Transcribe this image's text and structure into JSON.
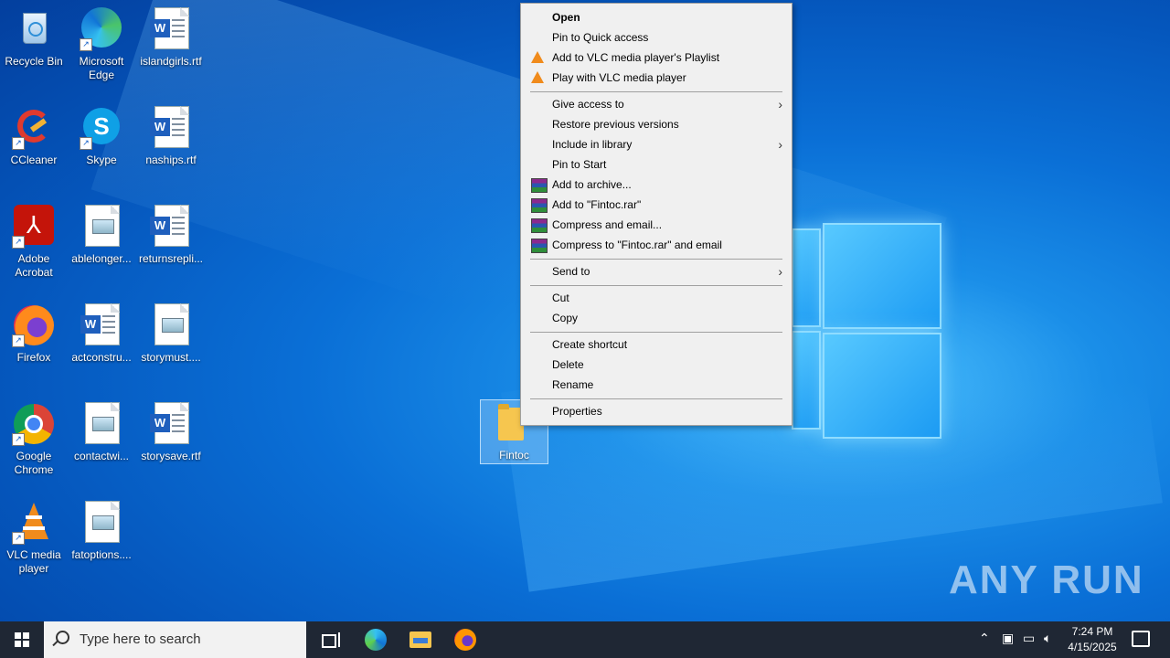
{
  "desktop_icons": [
    {
      "label": "Recycle Bin",
      "icon": "recycle-bin-icon"
    },
    {
      "label": "Microsoft Edge",
      "icon": "edge-icon"
    },
    {
      "label": "islandgirls.rtf",
      "icon": "word-doc-icon"
    },
    {
      "label": "CCleaner",
      "icon": "ccleaner-icon"
    },
    {
      "label": "Skype",
      "icon": "skype-icon"
    },
    {
      "label": "naships.rtf",
      "icon": "word-doc-icon"
    },
    {
      "label": "Adobe Acrobat",
      "icon": "acrobat-icon"
    },
    {
      "label": "ablelonger...",
      "icon": "image-doc-icon"
    },
    {
      "label": "returnsrepli...",
      "icon": "word-doc-icon"
    },
    {
      "label": "Firefox",
      "icon": "firefox-icon"
    },
    {
      "label": "actconstru...",
      "icon": "word-doc-icon"
    },
    {
      "label": "storymust....",
      "icon": "image-doc-icon"
    },
    {
      "label": "Google Chrome",
      "icon": "chrome-icon"
    },
    {
      "label": "contactwi...",
      "icon": "image-doc-icon"
    },
    {
      "label": "storysave.rtf",
      "icon": "word-doc-icon"
    },
    {
      "label": "VLC media player",
      "icon": "vlc-icon"
    },
    {
      "label": "fatoptions....",
      "icon": "image-doc-icon"
    }
  ],
  "selected_folder": {
    "label": "Fintoc",
    "icon": "folder-icon"
  },
  "context_menu": {
    "open": "Open",
    "pin_quick": "Pin to Quick access",
    "vlc_playlist": "Add to VLC media player's Playlist",
    "vlc_play": "Play with VLC media player",
    "give_access": "Give access to",
    "restore": "Restore previous versions",
    "include_library": "Include in library",
    "pin_start": "Pin to Start",
    "add_archive": "Add to archive...",
    "add_rar": "Add to \"Fintoc.rar\"",
    "compress_email": "Compress and email...",
    "compress_rar_email": "Compress to \"Fintoc.rar\" and email",
    "send_to": "Send to",
    "cut": "Cut",
    "copy": "Copy",
    "create_shortcut": "Create shortcut",
    "delete": "Delete",
    "rename": "Rename",
    "properties": "Properties"
  },
  "watermark": "ANY RUN",
  "taskbar": {
    "search_placeholder": "Type here to search",
    "time": "7:24 PM",
    "date": "4/15/2025"
  },
  "colors": {
    "taskbar": "#1f2734",
    "menu_bg": "#f0f0f0",
    "accent": "#0a6fd6"
  }
}
